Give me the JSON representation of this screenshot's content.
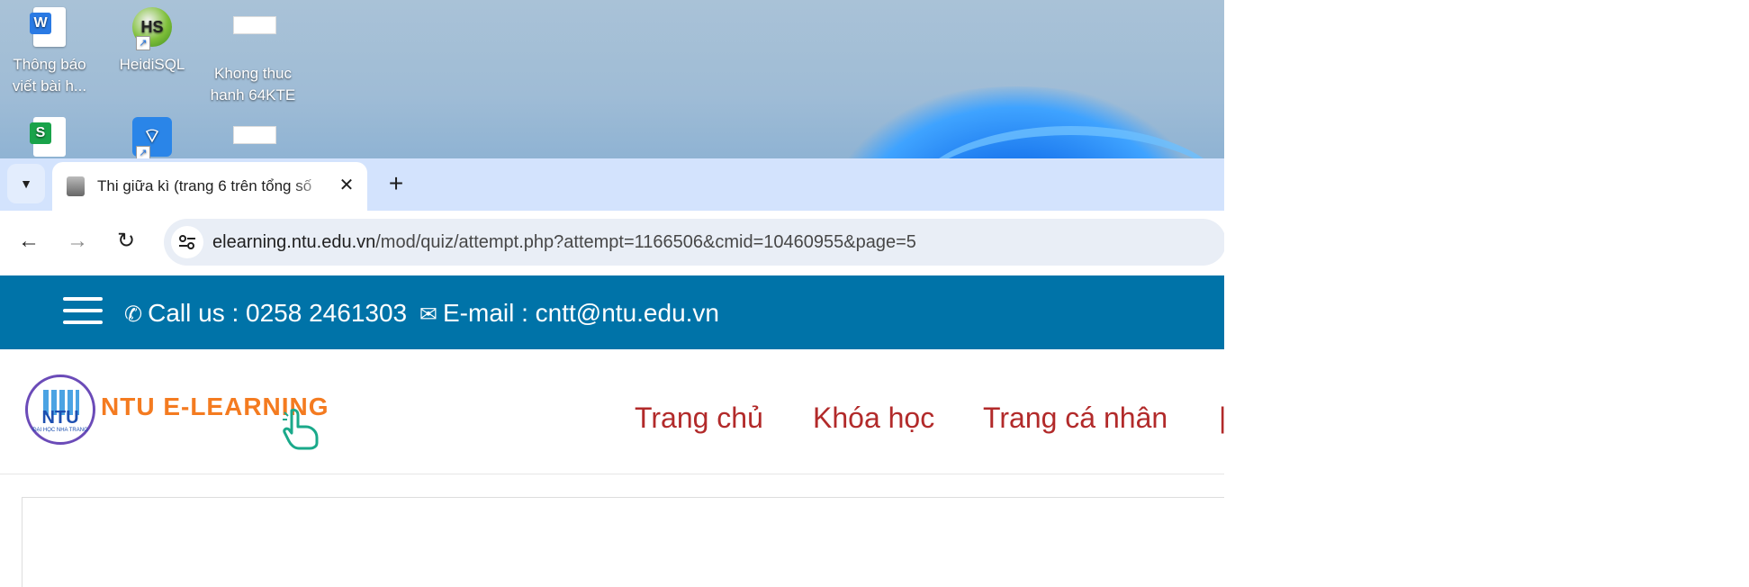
{
  "desktop": {
    "icons": [
      {
        "label": "Thông báo viết bài h...",
        "icon": "word-doc-icon"
      },
      {
        "label": "HeidiSQL",
        "icon": "heidisql-icon",
        "glyph": "HS"
      },
      {
        "label": "Khong thuc hanh 64KTE",
        "icon": "blank-file-icon"
      },
      {
        "label": "",
        "icon": "spreadsheet-icon"
      },
      {
        "label": "",
        "icon": "wifi-app-icon"
      },
      {
        "label": "",
        "icon": "blank-file-icon"
      }
    ]
  },
  "browser": {
    "tab_title": "Thi giữa kì (trang 6 trên tổng số",
    "url_host": "elearning.ntu.edu.vn",
    "url_path": "/mod/quiz/attempt.php?attempt=1166506&cmid=10460955&page=5"
  },
  "site": {
    "call_label": "Call us : 0258 2461303",
    "email_label": "E-mail : cntt@ntu.edu.vn",
    "logo_seal_text": "NTU",
    "logo_seal_subtext": "ĐẠI HỌC NHA TRANG",
    "logo_text": "NTU E-LEARNING",
    "menu": [
      {
        "label": "Trang chủ"
      },
      {
        "label": "Khóa học"
      },
      {
        "label": "Trang cá nhân"
      }
    ],
    "brand_color": "#0073a8",
    "menu_color": "#b22a2a"
  }
}
